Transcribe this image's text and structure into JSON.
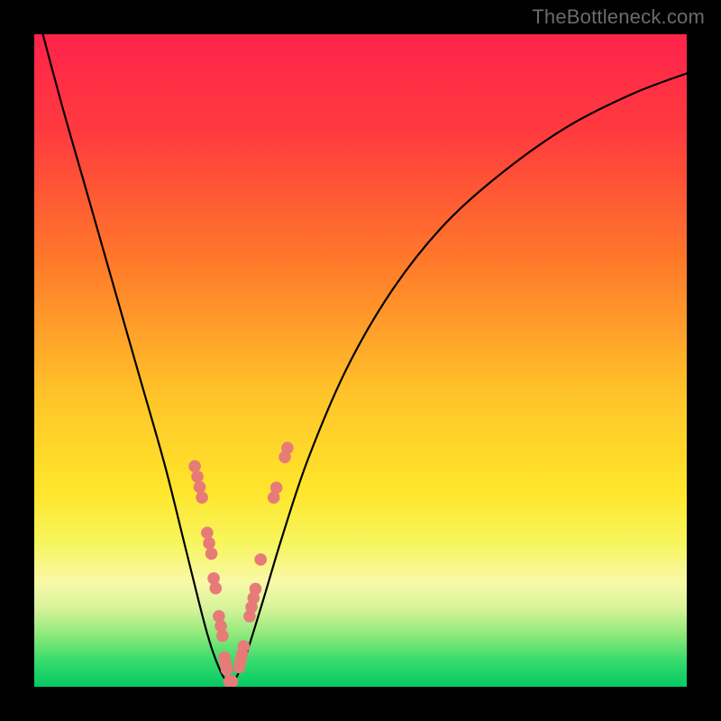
{
  "watermark": {
    "text": "TheBottleneck.com"
  },
  "chart_data": {
    "type": "line",
    "title": "",
    "xlabel": "",
    "ylabel": "",
    "xlim": [
      0,
      100
    ],
    "ylim": [
      0,
      100
    ],
    "gradient_stops": [
      {
        "offset": 0,
        "color": "#ff234b"
      },
      {
        "offset": 15,
        "color": "#ff3b3e"
      },
      {
        "offset": 35,
        "color": "#ff7a2a"
      },
      {
        "offset": 55,
        "color": "#ffc329"
      },
      {
        "offset": 70,
        "color": "#ffe62b"
      },
      {
        "offset": 78,
        "color": "#f7f55e"
      },
      {
        "offset": 84,
        "color": "#f8f9a8"
      },
      {
        "offset": 88,
        "color": "#d7f39a"
      },
      {
        "offset": 92,
        "color": "#8fe97b"
      },
      {
        "offset": 96,
        "color": "#37db6d"
      },
      {
        "offset": 100,
        "color": "#06c964"
      }
    ],
    "series": [
      {
        "name": "bottleneck-curve",
        "x": [
          0,
          4,
          8,
          12,
          16,
          20,
          23,
          26,
          27.5,
          29,
          30,
          31,
          32.5,
          35,
          38,
          42,
          48,
          55,
          63,
          72,
          82,
          92,
          100
        ],
        "y": [
          105,
          90,
          76,
          62,
          48,
          34,
          22,
          10,
          5,
          1.5,
          0.6,
          1.5,
          5,
          13,
          23,
          35,
          49,
          61,
          71,
          79,
          86,
          91,
          94
        ]
      }
    ],
    "marker_points": [
      {
        "x": 24.6,
        "y": 33.8
      },
      {
        "x": 25.0,
        "y": 32.2
      },
      {
        "x": 25.35,
        "y": 30.6
      },
      {
        "x": 25.7,
        "y": 29.0
      },
      {
        "x": 26.5,
        "y": 23.6
      },
      {
        "x": 26.8,
        "y": 22.0
      },
      {
        "x": 27.15,
        "y": 20.4
      },
      {
        "x": 27.5,
        "y": 16.6
      },
      {
        "x": 27.8,
        "y": 15.1
      },
      {
        "x": 28.3,
        "y": 10.8
      },
      {
        "x": 28.6,
        "y": 9.3
      },
      {
        "x": 28.85,
        "y": 7.8
      },
      {
        "x": 29.15,
        "y": 4.5
      },
      {
        "x": 29.35,
        "y": 3.5
      },
      {
        "x": 29.5,
        "y": 2.6
      },
      {
        "x": 29.9,
        "y": 0.8
      },
      {
        "x": 30.3,
        "y": 0.8
      },
      {
        "x": 31.4,
        "y": 3.0
      },
      {
        "x": 31.6,
        "y": 4.0
      },
      {
        "x": 31.85,
        "y": 5.0
      },
      {
        "x": 32.1,
        "y": 6.2
      },
      {
        "x": 33.0,
        "y": 10.8
      },
      {
        "x": 33.3,
        "y": 12.2
      },
      {
        "x": 33.6,
        "y": 13.6
      },
      {
        "x": 33.9,
        "y": 15.0
      },
      {
        "x": 34.7,
        "y": 19.5
      },
      {
        "x": 36.7,
        "y": 29.0
      },
      {
        "x": 37.1,
        "y": 30.5
      },
      {
        "x": 38.4,
        "y": 35.2
      },
      {
        "x": 38.8,
        "y": 36.6
      }
    ],
    "marker_color": "#e77b78",
    "curve_color": "#000000"
  }
}
